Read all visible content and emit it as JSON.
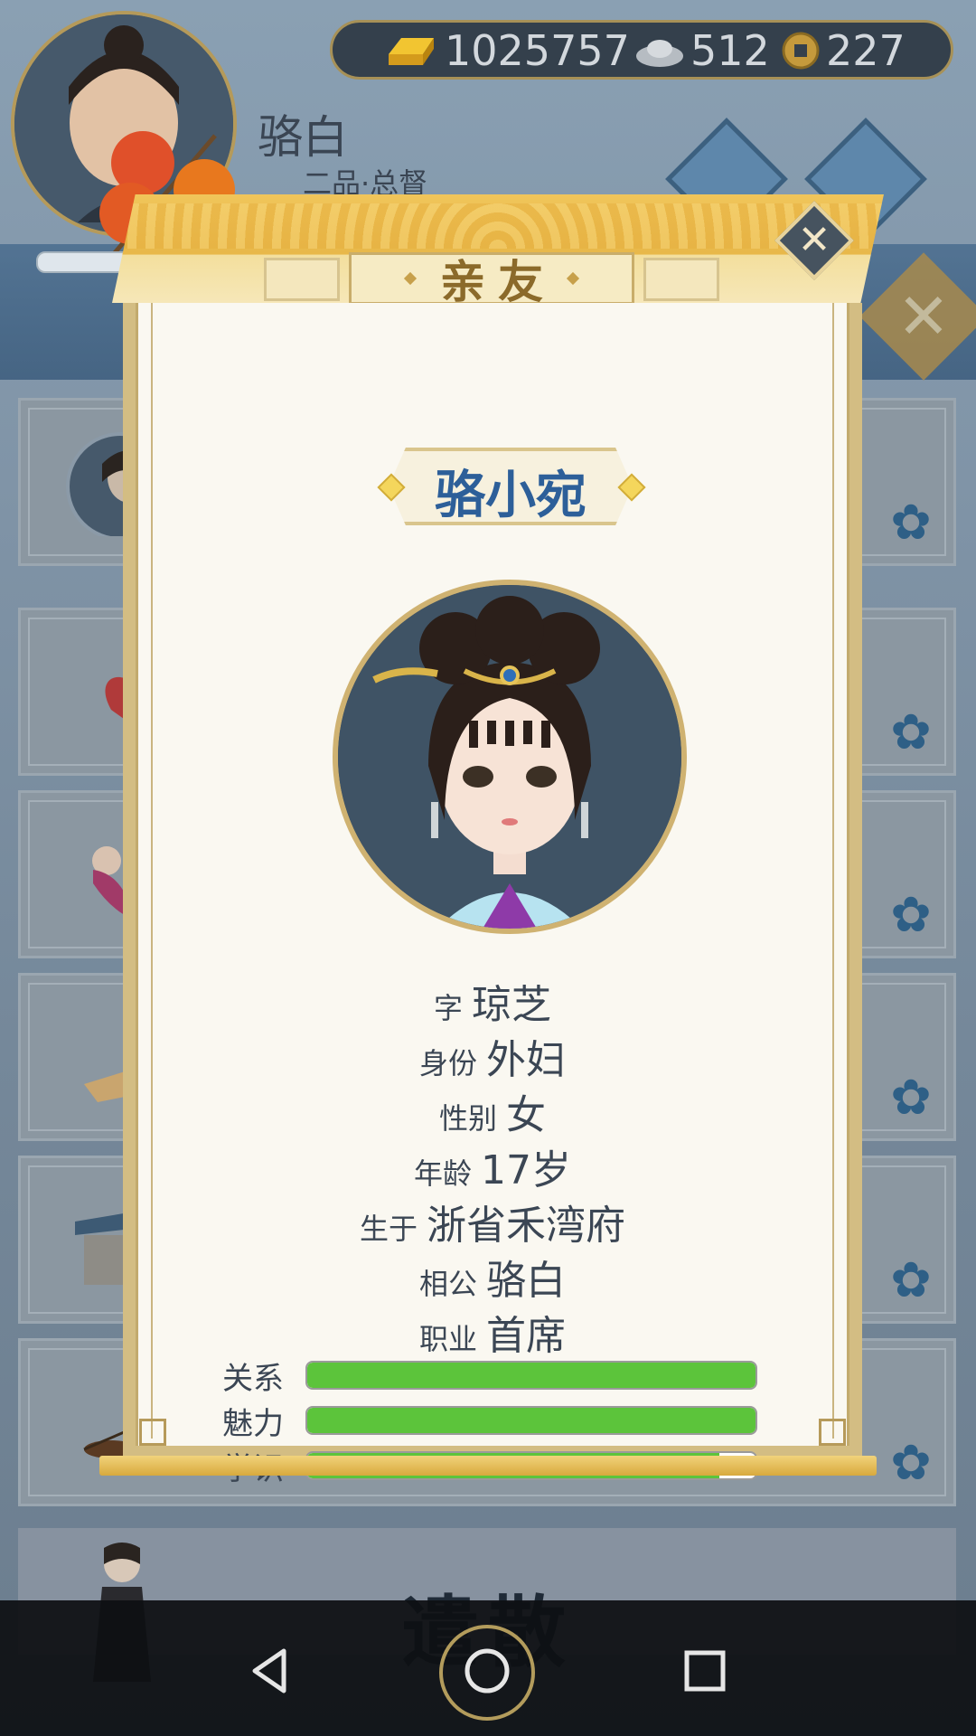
{
  "header": {
    "player_name": "骆白",
    "player_rank": "二品·总督",
    "currency": {
      "gold": "1025757",
      "silver": "512",
      "coin": "227"
    }
  },
  "background": {
    "dismiss_label": "遣散"
  },
  "modal": {
    "title": "亲友",
    "name": "骆小宛",
    "fields": [
      {
        "label": "字",
        "value": "琼芝"
      },
      {
        "label": "身份",
        "value": "外妇"
      },
      {
        "label": "性别",
        "value": "女"
      },
      {
        "label": "年龄",
        "value": "17岁"
      },
      {
        "label": "生于",
        "value": "浙省禾湾府"
      },
      {
        "label": "相公",
        "value": "骆白"
      },
      {
        "label": "职业",
        "value": "首席"
      }
    ],
    "stats": [
      {
        "label": "关系",
        "fraction": 1.0
      },
      {
        "label": "魅力",
        "fraction": 1.0
      },
      {
        "label": "学识",
        "fraction": 0.92
      }
    ]
  },
  "colors": {
    "name_blue": "#2d5f99",
    "bar_green": "#5cc43b",
    "gold_frame": "#e8b84a"
  },
  "icons": [
    "gold-ingot-icon",
    "silver-ingot-icon",
    "copper-coin-icon",
    "close-icon",
    "back-icon",
    "home-icon",
    "recents-icon",
    "flower-icon"
  ]
}
